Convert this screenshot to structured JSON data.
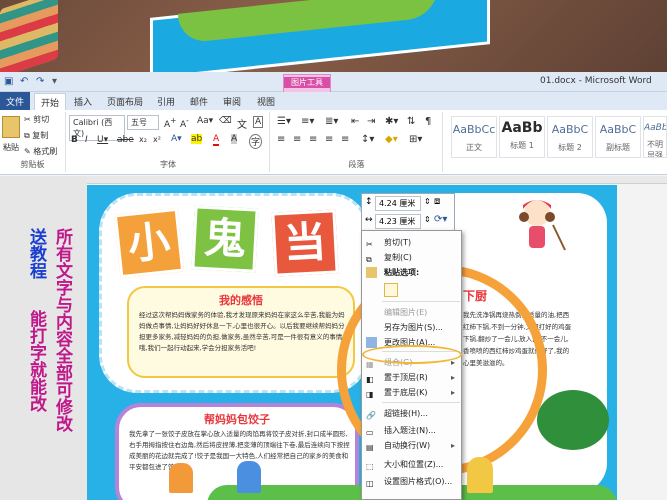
{
  "window": {
    "doc_title": "01.docx - Microsoft Word",
    "context_tab_group": "图片工具",
    "context_tab": "格式"
  },
  "tabs": [
    "文件",
    "开始",
    "插入",
    "页面布局",
    "引用",
    "邮件",
    "审阅",
    "视图"
  ],
  "ribbon": {
    "clipboard": {
      "paste": "粘贴",
      "cut": "剪切",
      "copy": "复制",
      "format_painter": "格式刷",
      "label": "剪贴板"
    },
    "font": {
      "name": "Calibri (西文)",
      "size": "五号",
      "label": "字体"
    },
    "paragraph": {
      "label": "段落"
    },
    "styles": [
      {
        "sample": "AaBbCc",
        "name": "正文"
      },
      {
        "sample": "AaBb",
        "name": "标题 1"
      },
      {
        "sample": "AaBbC",
        "name": "标题 2"
      },
      {
        "sample": "AaBbC",
        "name": "副标题"
      },
      {
        "sample": "AaBbC",
        "name": "不明显强调"
      }
    ]
  },
  "side_text": {
    "col1": "送教程",
    "col2": "能打字就能改",
    "col3": "所有文字与内容全部可修改"
  },
  "poster": {
    "title_chars": [
      "小",
      "鬼",
      "当"
    ],
    "title_colors": [
      "#f4a13b",
      "#7dc243",
      "#e8583d"
    ],
    "section1": {
      "heading": "我的感悟",
      "body": "经过这次帮妈妈做家务的体验,我才发现原来妈妈在家这么辛苦,我能为妈妈做点事情,让妈妈好好休息一下,心里也很开心。以后我要继续帮妈妈分担更多家务,减轻妈妈的负担,做家务,虽然辛苦,可是一件很有意义的事情哦,我们一起行动起来,学会分担家务活吧!"
    },
    "section2": {
      "heading": "帮妈妈包饺子",
      "body": "我先拿了一张饺子皮放在掌心放入适量的肉馅再将饺子皮对折,封口成半圆形,右手用拇指按住右边角,然后将皮捏薄,把变薄的顶端往下卷,最后连续向下按捏成美丽的花边就完成了!饺子是我国一大特色,人们经常把自己的家乡的美食和平安都包进了饺子里。"
    },
    "section3": {
      "heading": "下厨",
      "body": "我先洗净锅再烧热倒入适量的油,把西红柿下锅,不到一分钟,又把打好的鸡蛋下锅,翻炒了一会儿,放入盐,不一会儿,香喷喷的西红柿炒鸡蛋就做好了,我的心里美滋滋的。"
    }
  },
  "format_bar": {
    "width_value": "4.24 厘米",
    "height_value": "4.23 厘米"
  },
  "context_menu": [
    {
      "label": "剪切(T)",
      "icon": "scissors-icon",
      "enabled": true
    },
    {
      "label": "复制(C)",
      "icon": "copy-icon",
      "enabled": true
    },
    {
      "label": "粘贴选项:",
      "icon": "paste-icon",
      "enabled": true
    },
    {
      "label": "编辑图片(E)",
      "icon": "",
      "enabled": false
    },
    {
      "label": "另存为图片(S)...",
      "icon": "",
      "enabled": true
    },
    {
      "label": "更改图片(A)...",
      "icon": "change-picture-icon",
      "enabled": true
    },
    {
      "label": "组合(G)",
      "icon": "group-icon",
      "enabled": false,
      "submenu": true
    },
    {
      "label": "置于顶层(R)",
      "icon": "bring-front-icon",
      "enabled": true,
      "submenu": true
    },
    {
      "label": "置于底层(K)",
      "icon": "send-back-icon",
      "enabled": true,
      "submenu": true
    },
    {
      "label": "超链接(H)...",
      "icon": "hyperlink-icon",
      "enabled": true
    },
    {
      "label": "插入题注(N)...",
      "icon": "caption-icon",
      "enabled": true
    },
    {
      "label": "自动换行(W)",
      "icon": "wrap-icon",
      "enabled": true,
      "submenu": true
    },
    {
      "label": "大小和位置(Z)...",
      "icon": "size-icon",
      "enabled": true
    },
    {
      "label": "设置图片格式(O)...",
      "icon": "format-picture-icon",
      "enabled": true
    }
  ]
}
